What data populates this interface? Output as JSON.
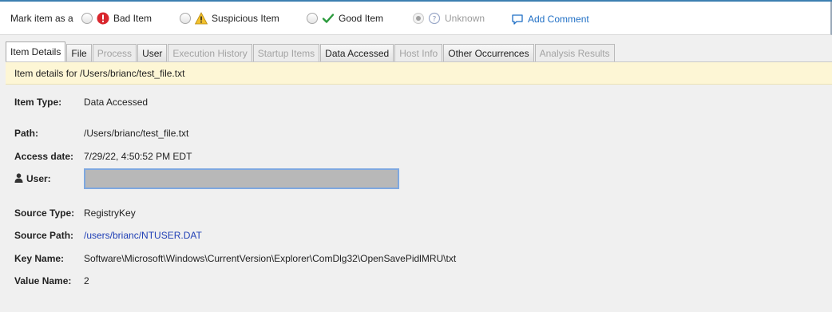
{
  "markbar": {
    "label": "Mark item as a",
    "options": [
      {
        "label": "Bad Item",
        "icon": "bad-item-icon",
        "selected": false,
        "disabled": false
      },
      {
        "label": "Suspicious Item",
        "icon": "warning-icon",
        "selected": false,
        "disabled": false
      },
      {
        "label": "Good Item",
        "icon": "checkmark-icon",
        "selected": false,
        "disabled": false
      },
      {
        "label": "Unknown",
        "icon": "question-icon",
        "selected": true,
        "disabled": true
      }
    ],
    "add_comment": "Add Comment"
  },
  "tabs": [
    {
      "label": "Item Details",
      "state": "active"
    },
    {
      "label": "File",
      "state": "enabled"
    },
    {
      "label": "Process",
      "state": "disabled"
    },
    {
      "label": "User",
      "state": "enabled"
    },
    {
      "label": "Execution History",
      "state": "disabled"
    },
    {
      "label": "Startup Items",
      "state": "disabled"
    },
    {
      "label": "Data Accessed",
      "state": "enabled"
    },
    {
      "label": "Host Info",
      "state": "disabled"
    },
    {
      "label": "Other Occurrences",
      "state": "enabled"
    },
    {
      "label": "Analysis Results",
      "state": "disabled"
    }
  ],
  "details": {
    "header": "Item details for /Users/brianc/test_file.txt",
    "item_type_label": "Item Type:",
    "item_type": "Data Accessed",
    "path_label": "Path:",
    "path": "/Users/brianc/test_file.txt",
    "access_date_label": "Access date:",
    "access_date": "7/29/22, 4:50:52 PM EDT",
    "user_label": "User:",
    "user_value": "",
    "source_type_label": "Source Type:",
    "source_type": "RegistryKey",
    "source_path_label": "Source Path:",
    "source_path": "/users/brianc/NTUSER.DAT",
    "key_name_label": "Key Name:",
    "key_name": "Software\\Microsoft\\Windows\\CurrentVersion\\Explorer\\ComDlg32\\OpenSavePidlMRU\\txt",
    "value_name_label": "Value Name:",
    "value_name": "2"
  },
  "colors": {
    "accent": "#3c7fb1",
    "link": "#1f6fc5",
    "info_bar": "#fdf6d5",
    "bad": "#d9272e",
    "warning": "#f2c12e",
    "good": "#2a9a3c"
  }
}
